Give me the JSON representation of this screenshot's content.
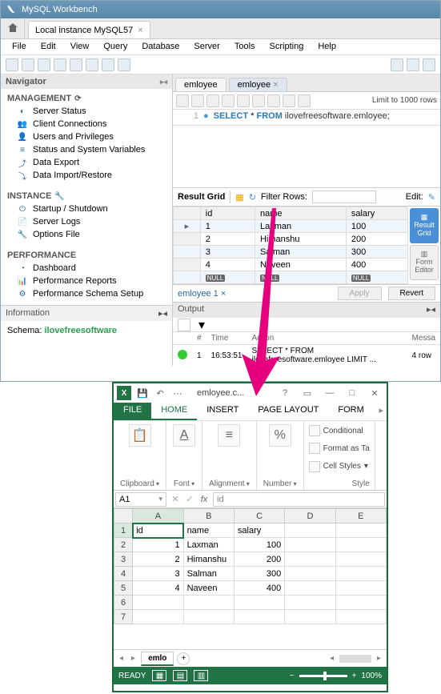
{
  "workbench": {
    "title": "MySQL Workbench",
    "connection_tab": "Local instance MySQL57",
    "menu": [
      "File",
      "Edit",
      "View",
      "Query",
      "Database",
      "Server",
      "Tools",
      "Scripting",
      "Help"
    ],
    "nav_header": "Navigator",
    "management": {
      "title": "MANAGEMENT",
      "items": [
        "Server Status",
        "Client Connections",
        "Users and Privileges",
        "Status and System Variables",
        "Data Export",
        "Data Import/Restore"
      ]
    },
    "instance": {
      "title": "INSTANCE",
      "items": [
        "Startup / Shutdown",
        "Server Logs",
        "Options File"
      ]
    },
    "performance": {
      "title": "PERFORMANCE",
      "items": [
        "Dashboard",
        "Performance Reports",
        "Performance Schema Setup"
      ]
    },
    "information": "Information",
    "schema_label": "Schema:",
    "schema_value": "ilovefreesoftware",
    "editor_tabs": [
      "emloyee",
      "emloyee"
    ],
    "limit": "Limit to 1000 rows",
    "sql": {
      "kw1": "SELECT",
      "star": "*",
      "kw2": "FROM",
      "ref": "ilovefreesoftware.emloyee;"
    },
    "result_label": "Result Grid",
    "filter_label": "Filter Rows:",
    "edit_label": "Edit:",
    "columns": [
      "id",
      "name",
      "salary"
    ],
    "rows": [
      {
        "id": "1",
        "name": "Laxman",
        "salary": "100"
      },
      {
        "id": "2",
        "name": "Himanshu",
        "salary": "200"
      },
      {
        "id": "3",
        "name": "Salman",
        "salary": "300"
      },
      {
        "id": "4",
        "name": "Naveen",
        "salary": "400"
      }
    ],
    "null_label": "NULL",
    "side_result": "Result Grid",
    "side_form": "Form Editor",
    "bottom_tab": "emloyee 1",
    "apply": "Apply",
    "revert": "Revert",
    "output": "Output",
    "out_cols": {
      "num": "#",
      "time": "Time",
      "action": "Action",
      "msg": "Messa"
    },
    "out_row": {
      "num": "1",
      "time": "16:53:51",
      "action": "SELECT * FROM ilovefreesoftware.emloyee LIMIT ...",
      "msg": "4 row"
    }
  },
  "excel": {
    "filename": "emloyee.c...",
    "tabs": {
      "file": "FILE",
      "home": "HOME",
      "insert": "INSERT",
      "pagelayout": "PAGE LAYOUT",
      "formulas": "FORM"
    },
    "groups": {
      "clipboard": "Clipboard",
      "font": "Font",
      "alignment": "Alignment",
      "number": "Number"
    },
    "styles": {
      "conditional": "Conditional",
      "formatas": "Format as Ta",
      "cellstyles": "Cell Styles",
      "section": "Style"
    },
    "namebox": "A1",
    "formula": "id",
    "cols": [
      "A",
      "B",
      "C",
      "D",
      "E"
    ],
    "rows": [
      {
        "n": "1",
        "A": "id",
        "B": "name",
        "C": "salary",
        "D": "",
        "E": ""
      },
      {
        "n": "2",
        "A": "1",
        "B": "Laxman",
        "C": "100",
        "D": "",
        "E": ""
      },
      {
        "n": "3",
        "A": "2",
        "B": "Himanshu",
        "C": "200",
        "D": "",
        "E": ""
      },
      {
        "n": "4",
        "A": "3",
        "B": "Salman",
        "C": "300",
        "D": "",
        "E": ""
      },
      {
        "n": "5",
        "A": "4",
        "B": "Naveen",
        "C": "400",
        "D": "",
        "E": ""
      },
      {
        "n": "6",
        "A": "",
        "B": "",
        "C": "",
        "D": "",
        "E": ""
      },
      {
        "n": "7",
        "A": "",
        "B": "",
        "C": "",
        "D": "",
        "E": ""
      }
    ],
    "sheet_tab": "emlo",
    "status": "READY",
    "zoom": "100%"
  },
  "chart_data": {
    "type": "table",
    "columns": [
      "id",
      "name",
      "salary"
    ],
    "rows": [
      [
        1,
        "Laxman",
        100
      ],
      [
        2,
        "Himanshu",
        200
      ],
      [
        3,
        "Salman",
        300
      ],
      [
        4,
        "Naveen",
        400
      ]
    ]
  }
}
